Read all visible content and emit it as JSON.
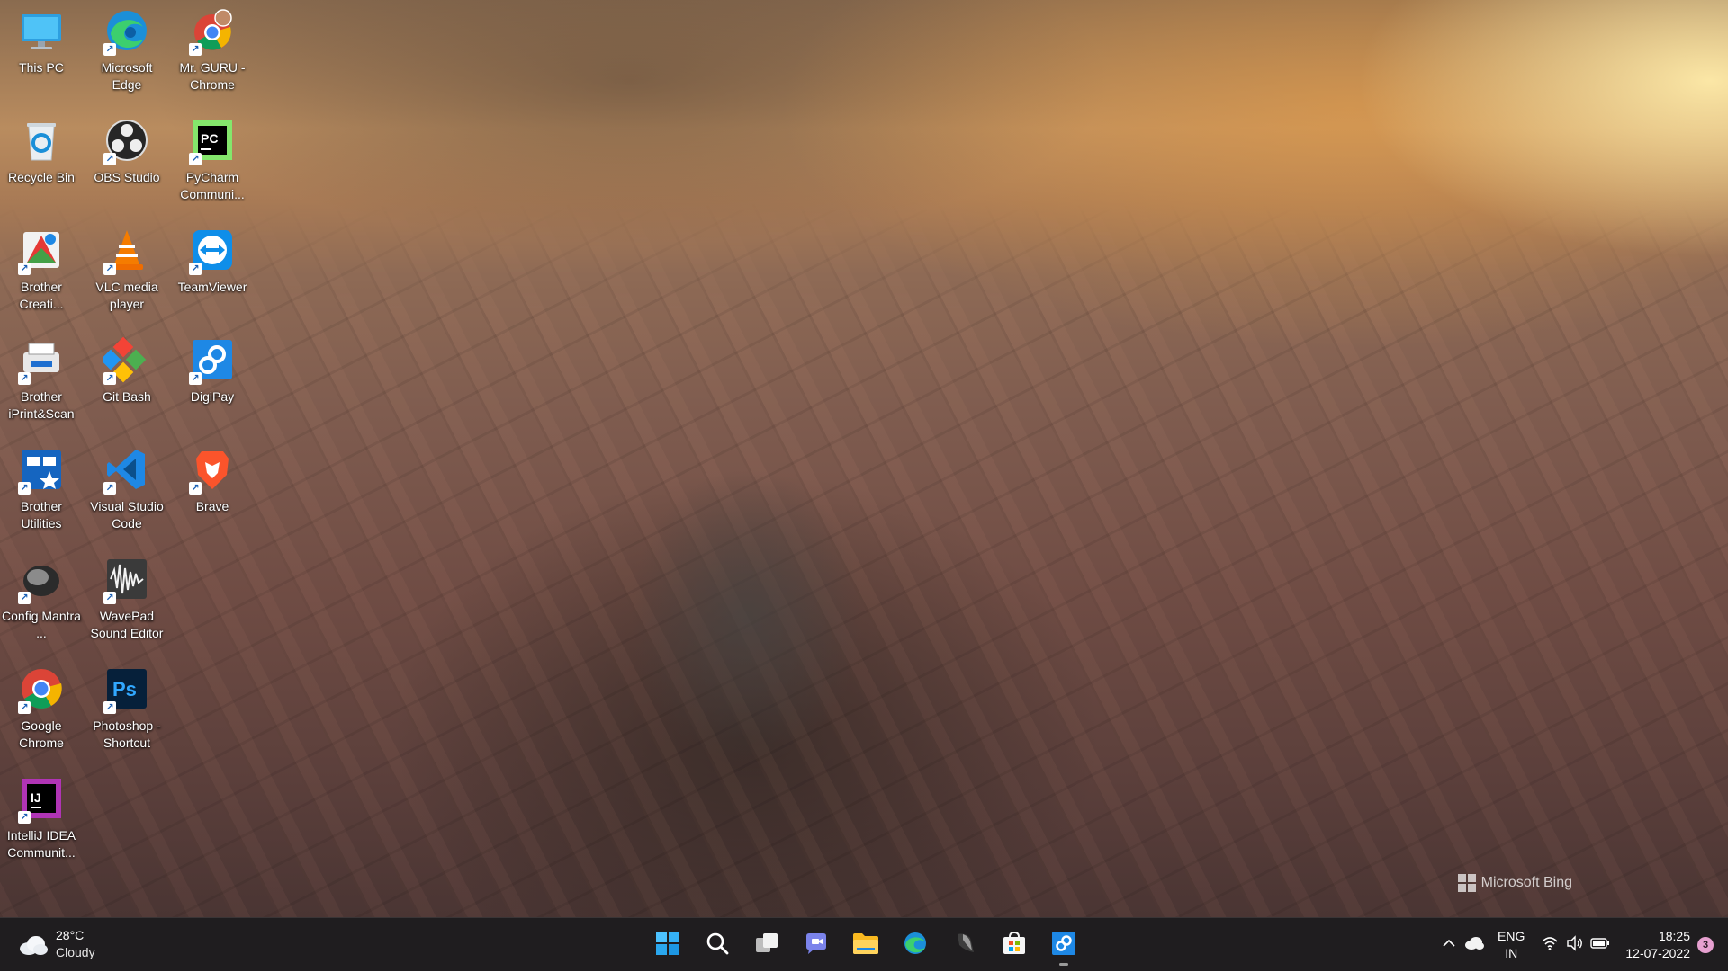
{
  "desktop": {
    "icons": [
      {
        "label": "This PC",
        "icon": "computer-icon"
      },
      {
        "label": "Microsoft Edge",
        "icon": "edge-icon"
      },
      {
        "label": "Mr. GURU - Chrome",
        "icon": "chrome-profile-icon"
      },
      {
        "label": "Recycle Bin",
        "icon": "recycle-bin-icon"
      },
      {
        "label": "OBS Studio",
        "icon": "obs-icon"
      },
      {
        "label": "PyCharm Communi...",
        "icon": "pycharm-icon"
      },
      {
        "label": "Brother Creati...",
        "icon": "brother-creative-icon"
      },
      {
        "label": "VLC media player",
        "icon": "vlc-icon"
      },
      {
        "label": "TeamViewer",
        "icon": "teamviewer-icon"
      },
      {
        "label": "Brother iPrint&Scan",
        "icon": "brother-iprint-icon"
      },
      {
        "label": "Git Bash",
        "icon": "git-bash-icon"
      },
      {
        "label": "DigiPay",
        "icon": "digipay-icon"
      },
      {
        "label": "Brother Utilities",
        "icon": "brother-utilities-icon"
      },
      {
        "label": "Visual Studio Code",
        "icon": "vscode-icon"
      },
      {
        "label": "Brave",
        "icon": "brave-icon"
      },
      {
        "label": "Config Mantra ...",
        "icon": "config-mantra-icon"
      },
      {
        "label": "WavePad Sound Editor",
        "icon": "wavepad-icon"
      },
      {
        "label": "Google Chrome",
        "icon": "chrome-icon"
      },
      {
        "label": "Photoshop - Shortcut",
        "icon": "photoshop-icon"
      },
      {
        "label": "IntelliJ IDEA Communit...",
        "icon": "intellij-icon"
      }
    ],
    "watermark": "Microsoft Bing"
  },
  "taskbar": {
    "weather": {
      "temp": "28°C",
      "condition": "Cloudy"
    },
    "pinned": [
      {
        "name": "start-button",
        "icon": "windows-start-icon"
      },
      {
        "name": "search-button",
        "icon": "search-icon"
      },
      {
        "name": "task-view-button",
        "icon": "task-view-icon"
      },
      {
        "name": "teams-chat-button",
        "icon": "teams-chat-icon"
      },
      {
        "name": "file-explorer-button",
        "icon": "folder-icon"
      },
      {
        "name": "edge-taskbar-button",
        "icon": "edge-icon"
      },
      {
        "name": "obs-taskbar-button",
        "icon": "obs-icon"
      },
      {
        "name": "store-taskbar-button",
        "icon": "store-icon"
      },
      {
        "name": "digipay-taskbar-button",
        "icon": "digipay-icon"
      }
    ],
    "tray": {
      "lang_top": "ENG",
      "lang_bottom": "IN",
      "time": "18:25",
      "date": "12-07-2022",
      "notification_count": "3"
    }
  }
}
